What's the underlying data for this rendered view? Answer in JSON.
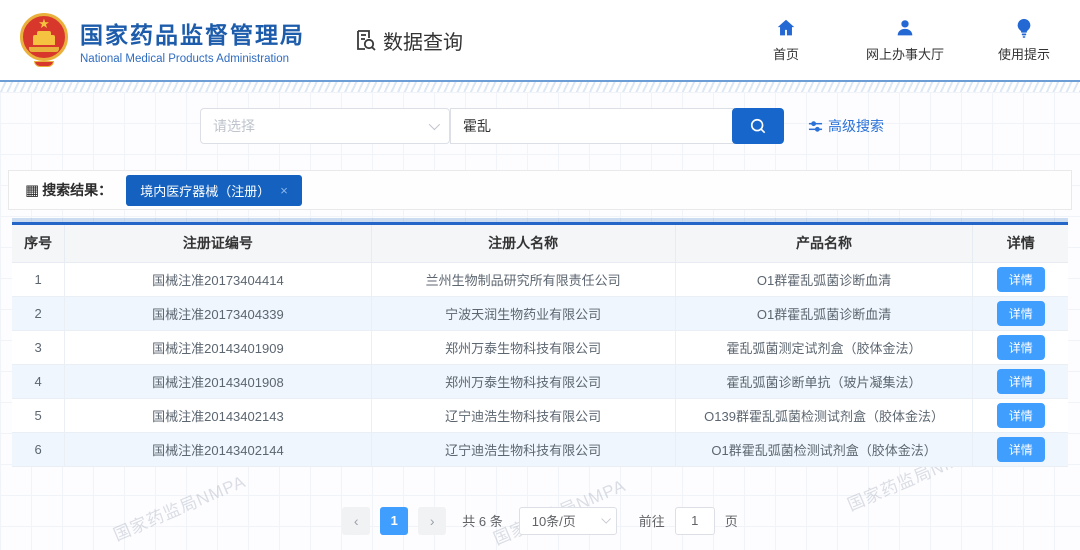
{
  "header": {
    "title": "国家药品监督管理局",
    "subtitle": "National Medical Products Administration",
    "section_title": "数据查询",
    "nav": [
      {
        "label": "首页",
        "icon": "home-icon"
      },
      {
        "label": "网上办事大厅",
        "icon": "user-icon"
      },
      {
        "label": "使用提示",
        "icon": "bulb-icon"
      }
    ]
  },
  "search": {
    "category_placeholder": "请选择",
    "keyword_value": "霍乱",
    "advanced_label": "高级搜索"
  },
  "results": {
    "label": "搜索结果：",
    "grid_icon": "▦",
    "tag": "境内医疗器械（注册）",
    "tag_close": "×"
  },
  "table": {
    "headers": [
      "序号",
      "注册证编号",
      "注册人名称",
      "产品名称",
      "详情"
    ],
    "detail_label": "详情",
    "rows": [
      {
        "index": "1",
        "cert_no": "国械注准20173404414",
        "registrant": "兰州生物制品研究所有限责任公司",
        "product": "O1群霍乱弧菌诊断血清"
      },
      {
        "index": "2",
        "cert_no": "国械注准20173404339",
        "registrant": "宁波天润生物药业有限公司",
        "product": "O1群霍乱弧菌诊断血清"
      },
      {
        "index": "3",
        "cert_no": "国械注准20143401909",
        "registrant": "郑州万泰生物科技有限公司",
        "product": "霍乱弧菌测定试剂盒（胶体金法）"
      },
      {
        "index": "4",
        "cert_no": "国械注准20143401908",
        "registrant": "郑州万泰生物科技有限公司",
        "product": "霍乱弧菌诊断单抗（玻片凝集法）"
      },
      {
        "index": "5",
        "cert_no": "国械注准20143402143",
        "registrant": "辽宁迪浩生物科技有限公司",
        "product": "O139群霍乱弧菌检测试剂盒（胶体金法）"
      },
      {
        "index": "6",
        "cert_no": "国械注准20143402144",
        "registrant": "辽宁迪浩生物科技有限公司",
        "product": "O1群霍乱弧菌检测试剂盒（胶体金法）"
      }
    ]
  },
  "pagination": {
    "prev": "‹",
    "next": "›",
    "page": "1",
    "total": "共 6 条",
    "page_size": "10条/页",
    "goto_label": "前往",
    "goto_value": "1",
    "goto_unit": "页"
  },
  "watermark": "国家药监局NMPA",
  "colors": {
    "brand_blue": "#1d5cab",
    "primary_blue": "#1766cc",
    "tag_blue": "#1461bf",
    "button_blue": "#409eff",
    "emblem_red": "#d8382c",
    "emblem_gold": "#e9b13c"
  }
}
